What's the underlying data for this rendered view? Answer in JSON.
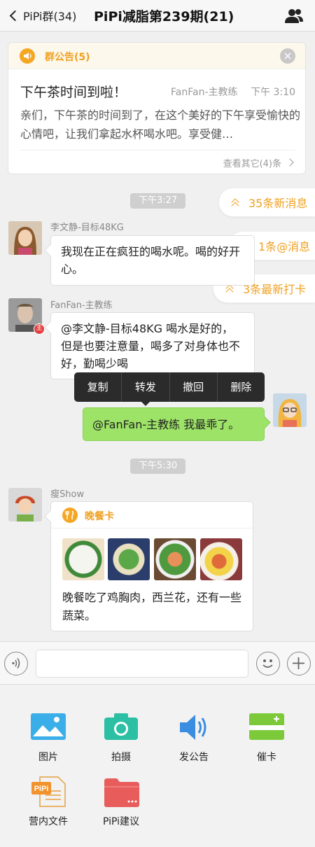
{
  "header": {
    "back_label": "PiPi群(34)",
    "title": "PiPi减脂第239期(21)"
  },
  "announcement": {
    "label": "群公告(5)",
    "title": "下午茶时间到啦！",
    "author": "FanFan-主教练",
    "time": "下午 3:10",
    "body": "亲们，下午茶的时间到了，在这个美好的下午享受愉快的心情吧，让我们拿起水杯喝水吧。享受健…",
    "more": "查看其它(4)条"
  },
  "notices": [
    "35条新消息",
    "1条@消息",
    "3条最新打卡"
  ],
  "times": [
    "下午3:27",
    "下午5:30"
  ],
  "messages": [
    {
      "sender": "李文静-目标48KG",
      "text": "我现在正在疯狂的喝水呢。喝的好开心。"
    },
    {
      "sender": "FanFan-主教练",
      "badge": "主",
      "text": "@李文静-目标48KG 喝水是好的，但是也要注意量，喝多了对身体也不好，勤喝少喝"
    },
    {
      "sender": "",
      "text": "@FanFan-主教练 我最乖了。"
    }
  ],
  "context_menu": [
    "复制",
    "转发",
    "撤回",
    "删除"
  ],
  "dinner_card": {
    "sender": "瘦Show",
    "label": "晚餐卡",
    "text": "晚餐吃了鸡胸肉，西兰花，还有一些蔬菜。"
  },
  "extensions": [
    "图片",
    "拍摄",
    "发公告",
    "催卡",
    "营内文件",
    "PiPi建议"
  ],
  "colors": {
    "accent": "#f0a020",
    "my_bubble": "#9de367",
    "context_menu": "#2b2b2b"
  }
}
